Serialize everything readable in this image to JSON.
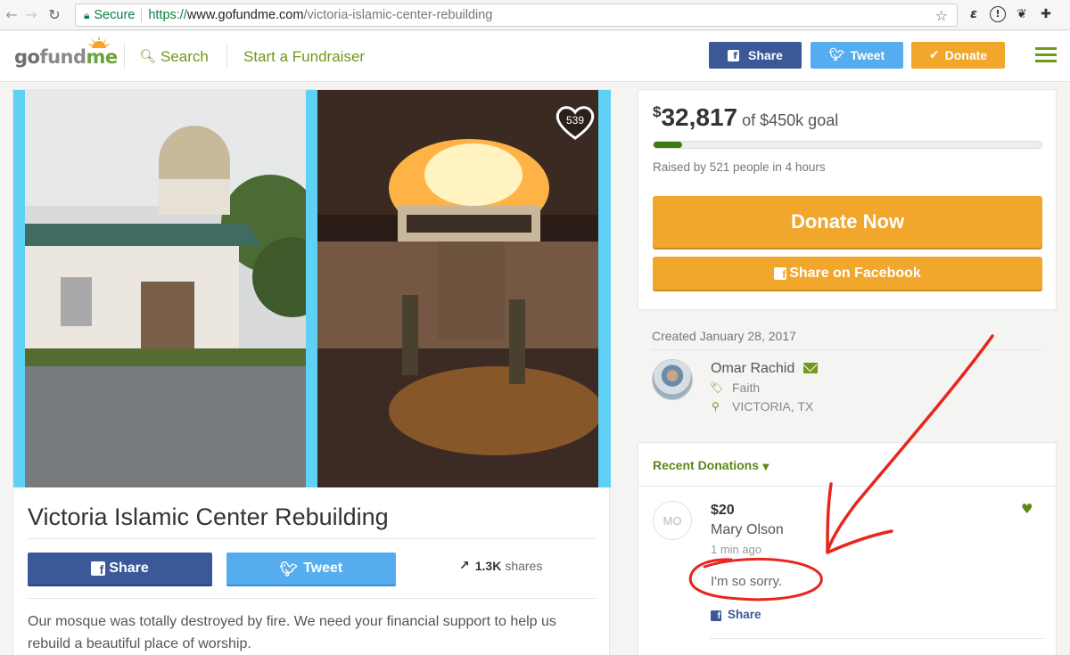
{
  "browser": {
    "secure_label": "Secure",
    "url_scheme": "https://",
    "url_host": "www.gofundme.com",
    "url_path": "/victoria-islamic-center-rebuilding"
  },
  "header": {
    "logo_go": "go",
    "logo_fund": "fund",
    "logo_me": "me",
    "search_label": "Search",
    "start_label": "Start a Fundraiser",
    "share_label": "Share",
    "tweet_label": "Tweet",
    "donate_label": "Donate",
    "colors": {
      "share": "#3b5998",
      "tweet": "#55acee",
      "donate": "#f0a72c",
      "accent": "#6f9a1a"
    }
  },
  "campaign": {
    "heart_count": "539",
    "title": "Victoria Islamic Center Rebuilding",
    "share_label": "Share",
    "tweet_label": "Tweet",
    "shares_count": "1.3K",
    "shares_label": "shares",
    "story": "Our mosque was totally destroyed by fire. We need your financial support to help us rebuild a beautiful place of worship."
  },
  "summary": {
    "currency": "$",
    "raised": "32,817",
    "goal_text": "of $450k goal",
    "progress_fraction": 0.073,
    "raised_meta": "Raised by 521 people in 4 hours",
    "donate_now_label": "Donate Now",
    "share_fb_label": "Share on Facebook"
  },
  "organizer": {
    "created": "Created January 28, 2017",
    "name": "Omar Rachid",
    "category": "Faith",
    "location": "VICTORIA, TX"
  },
  "donations": {
    "heading": "Recent Donations",
    "items": [
      {
        "initials": "MO",
        "amount": "$20",
        "name": "Mary Olson",
        "time": "1 min ago",
        "message": "I'm so sorry.",
        "share_label": "Share"
      }
    ]
  }
}
